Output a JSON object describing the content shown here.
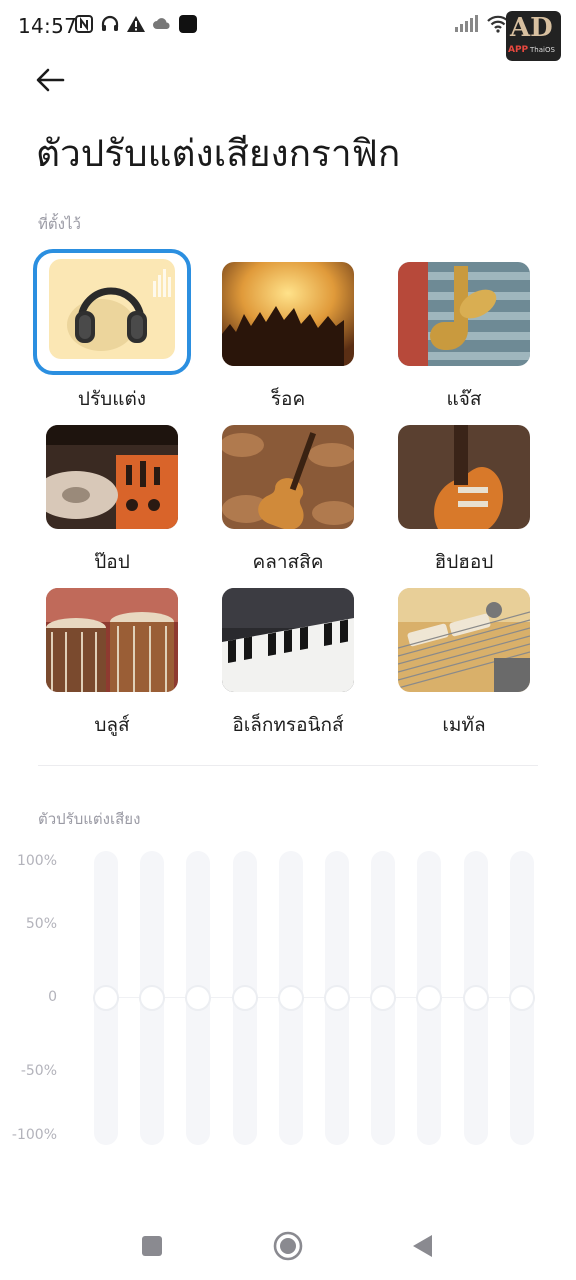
{
  "status_bar": {
    "time": "14:57",
    "left_icons": [
      "nfc-icon",
      "headset-icon",
      "alert-icon",
      "cloud-icon",
      "app-square-icon"
    ],
    "right_icons": [
      "signal-icon",
      "wifi-icon"
    ],
    "watermark": {
      "mark": "AD",
      "brand": "APP",
      "sub": "ThaiOS"
    }
  },
  "header": {
    "back_icon": "arrow-left-icon",
    "title": "ตัวปรับแต่งเสียงกราฟิก"
  },
  "presets": {
    "section_label": "ที่ตั้งไว้",
    "selected": "ปรับแต่ง",
    "items": [
      {
        "label": "ปรับแต่ง",
        "image": "headphones"
      },
      {
        "label": "ร็อค",
        "image": "concert-crowd"
      },
      {
        "label": "แจ๊ส",
        "image": "saxophone"
      },
      {
        "label": "ป๊อป",
        "image": "dj-turntable"
      },
      {
        "label": "คลาสสิค",
        "image": "violin"
      },
      {
        "label": "ฮิปฮอป",
        "image": "electric-guitar"
      },
      {
        "label": "บลูส์",
        "image": "drums"
      },
      {
        "label": "อิเล็กทรอนิกส์",
        "image": "synth-keyboard"
      },
      {
        "label": "เมทัล",
        "image": "guitar-pickups"
      }
    ]
  },
  "equalizer": {
    "section_label": "ตัวปรับแต่งเสียง",
    "y_ticks": [
      "100%",
      "50%",
      "0",
      "-50%",
      "-100%"
    ],
    "bands_percent": [
      0,
      0,
      0,
      0,
      0,
      0,
      0,
      0,
      0,
      0
    ]
  },
  "nav_bar": {
    "buttons": [
      "recents-square-icon",
      "home-circle-icon",
      "back-triangle-icon"
    ]
  },
  "colors": {
    "accent": "#2b8fe0",
    "text": "#1e1e1e",
    "muted": "#9a9aa4",
    "track": "#f5f6f9"
  }
}
